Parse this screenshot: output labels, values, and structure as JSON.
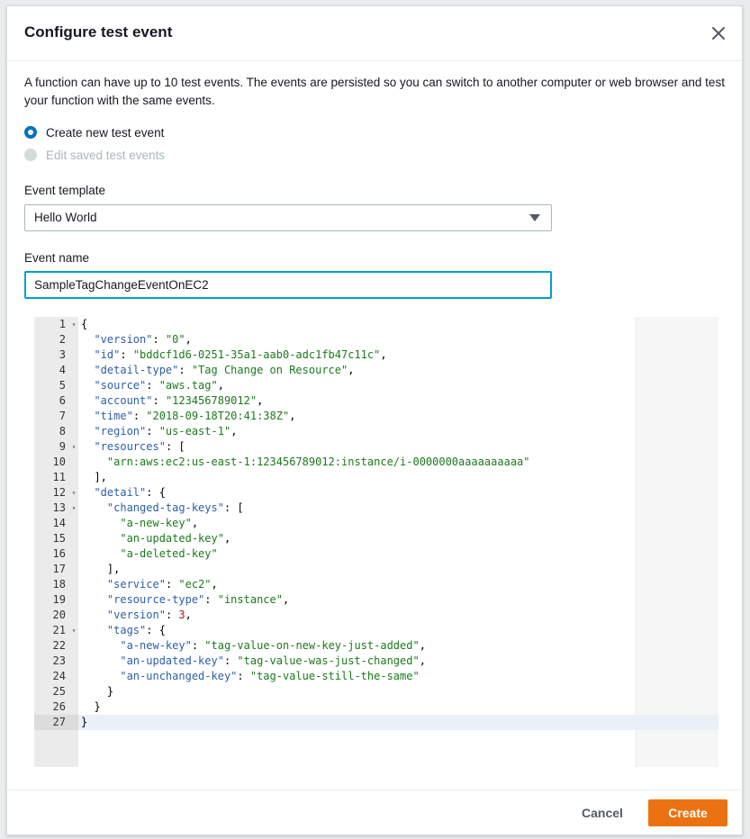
{
  "dialog": {
    "title": "Configure test event",
    "close_icon": "close-icon",
    "description": "A function can have up to 10 test events. The events are persisted so you can switch to another computer or web browser and test your function with the same events."
  },
  "options": {
    "create_new": "Create new test event",
    "edit_saved": "Edit saved test events",
    "selected": "create_new"
  },
  "template": {
    "label": "Event template",
    "value": "Hello World"
  },
  "event_name": {
    "label": "Event name",
    "value": "SampleTagChangeEventOnEC2"
  },
  "editor": {
    "active_line": 27,
    "lines": [
      {
        "n": "1",
        "fold": true,
        "t": [
          [
            "p",
            "{"
          ]
        ]
      },
      {
        "n": "2",
        "t": [
          [
            "p",
            "  "
          ],
          [
            "k",
            "\"version\""
          ],
          [
            "p",
            ": "
          ],
          [
            "s",
            "\"0\""
          ],
          [
            "p",
            ","
          ]
        ]
      },
      {
        "n": "3",
        "t": [
          [
            "p",
            "  "
          ],
          [
            "k",
            "\"id\""
          ],
          [
            "p",
            ": "
          ],
          [
            "s",
            "\"bddcf1d6-0251-35a1-aab0-adc1fb47c11c\""
          ],
          [
            "p",
            ","
          ]
        ]
      },
      {
        "n": "4",
        "t": [
          [
            "p",
            "  "
          ],
          [
            "k",
            "\"detail-type\""
          ],
          [
            "p",
            ": "
          ],
          [
            "s",
            "\"Tag Change on Resource\""
          ],
          [
            "p",
            ","
          ]
        ]
      },
      {
        "n": "5",
        "t": [
          [
            "p",
            "  "
          ],
          [
            "k",
            "\"source\""
          ],
          [
            "p",
            ": "
          ],
          [
            "s",
            "\"aws.tag\""
          ],
          [
            "p",
            ","
          ]
        ]
      },
      {
        "n": "6",
        "t": [
          [
            "p",
            "  "
          ],
          [
            "k",
            "\"account\""
          ],
          [
            "p",
            ": "
          ],
          [
            "s",
            "\"123456789012\""
          ],
          [
            "p",
            ","
          ]
        ]
      },
      {
        "n": "7",
        "t": [
          [
            "p",
            "  "
          ],
          [
            "k",
            "\"time\""
          ],
          [
            "p",
            ": "
          ],
          [
            "s",
            "\"2018-09-18T20:41:38Z\""
          ],
          [
            "p",
            ","
          ]
        ]
      },
      {
        "n": "8",
        "t": [
          [
            "p",
            "  "
          ],
          [
            "k",
            "\"region\""
          ],
          [
            "p",
            ": "
          ],
          [
            "s",
            "\"us-east-1\""
          ],
          [
            "p",
            ","
          ]
        ]
      },
      {
        "n": "9",
        "fold": true,
        "t": [
          [
            "p",
            "  "
          ],
          [
            "k",
            "\"resources\""
          ],
          [
            "p",
            ": ["
          ]
        ]
      },
      {
        "n": "10",
        "t": [
          [
            "p",
            "    "
          ],
          [
            "s",
            "\"arn:aws:ec2:us-east-1:123456789012:instance/i-0000000aaaaaaaaaa\""
          ]
        ]
      },
      {
        "n": "11",
        "t": [
          [
            "p",
            "  ],"
          ]
        ]
      },
      {
        "n": "12",
        "fold": true,
        "t": [
          [
            "p",
            "  "
          ],
          [
            "k",
            "\"detail\""
          ],
          [
            "p",
            ": {"
          ]
        ]
      },
      {
        "n": "13",
        "fold": true,
        "t": [
          [
            "p",
            "    "
          ],
          [
            "k",
            "\"changed-tag-keys\""
          ],
          [
            "p",
            ": ["
          ]
        ]
      },
      {
        "n": "14",
        "t": [
          [
            "p",
            "      "
          ],
          [
            "s",
            "\"a-new-key\""
          ],
          [
            "p",
            ","
          ]
        ]
      },
      {
        "n": "15",
        "t": [
          [
            "p",
            "      "
          ],
          [
            "s",
            "\"an-updated-key\""
          ],
          [
            "p",
            ","
          ]
        ]
      },
      {
        "n": "16",
        "t": [
          [
            "p",
            "      "
          ],
          [
            "s",
            "\"a-deleted-key\""
          ]
        ]
      },
      {
        "n": "17",
        "t": [
          [
            "p",
            "    ],"
          ]
        ]
      },
      {
        "n": "18",
        "t": [
          [
            "p",
            "    "
          ],
          [
            "k",
            "\"service\""
          ],
          [
            "p",
            ": "
          ],
          [
            "s",
            "\"ec2\""
          ],
          [
            "p",
            ","
          ]
        ]
      },
      {
        "n": "19",
        "t": [
          [
            "p",
            "    "
          ],
          [
            "k",
            "\"resource-type\""
          ],
          [
            "p",
            ": "
          ],
          [
            "s",
            "\"instance\""
          ],
          [
            "p",
            ","
          ]
        ]
      },
      {
        "n": "20",
        "t": [
          [
            "p",
            "    "
          ],
          [
            "k",
            "\"version\""
          ],
          [
            "p",
            ": "
          ],
          [
            "n",
            "3"
          ],
          [
            "p",
            ","
          ]
        ]
      },
      {
        "n": "21",
        "fold": true,
        "t": [
          [
            "p",
            "    "
          ],
          [
            "k",
            "\"tags\""
          ],
          [
            "p",
            ": {"
          ]
        ]
      },
      {
        "n": "22",
        "t": [
          [
            "p",
            "      "
          ],
          [
            "k",
            "\"a-new-key\""
          ],
          [
            "p",
            ": "
          ],
          [
            "s",
            "\"tag-value-on-new-key-just-added\""
          ],
          [
            "p",
            ","
          ]
        ]
      },
      {
        "n": "23",
        "t": [
          [
            "p",
            "      "
          ],
          [
            "k",
            "\"an-updated-key\""
          ],
          [
            "p",
            ": "
          ],
          [
            "s",
            "\"tag-value-was-just-changed\""
          ],
          [
            "p",
            ","
          ]
        ]
      },
      {
        "n": "24",
        "t": [
          [
            "p",
            "      "
          ],
          [
            "k",
            "\"an-unchanged-key\""
          ],
          [
            "p",
            ": "
          ],
          [
            "s",
            "\"tag-value-still-the-same\""
          ]
        ]
      },
      {
        "n": "25",
        "t": [
          [
            "p",
            "    }"
          ]
        ]
      },
      {
        "n": "26",
        "t": [
          [
            "p",
            "  }"
          ]
        ]
      },
      {
        "n": "27",
        "t": [
          [
            "p",
            "}"
          ]
        ]
      }
    ]
  },
  "footer": {
    "cancel_label": "Cancel",
    "create_label": "Create"
  },
  "colors": {
    "primary": "#ec7211",
    "radio_selected": "#0073bb",
    "input_focus": "#00a1c9"
  }
}
